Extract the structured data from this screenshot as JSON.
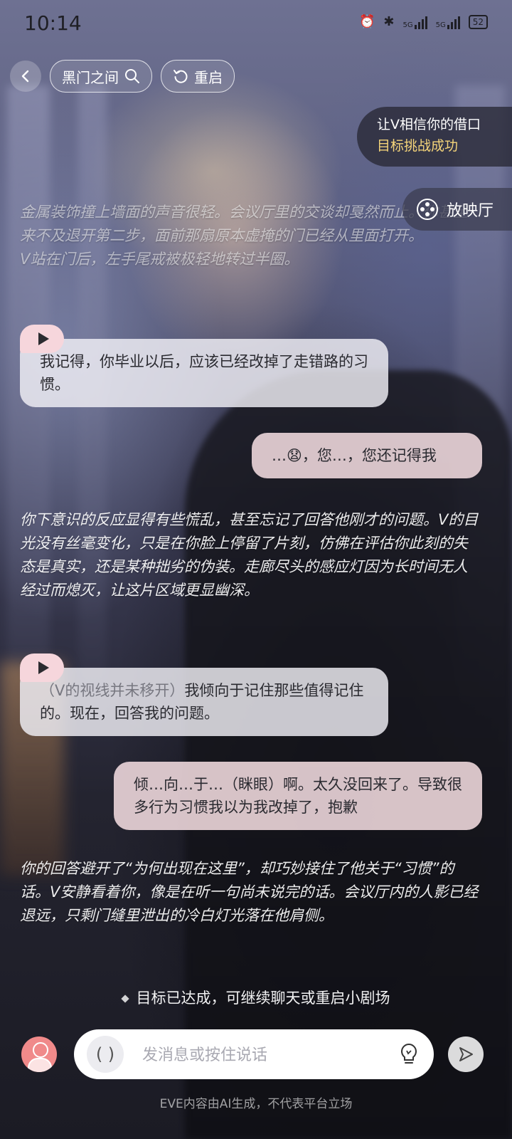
{
  "status_bar": {
    "time": "10:14",
    "battery": "52",
    "network_1": "5G",
    "network_2": "5G"
  },
  "topbar": {
    "back_icon": "chevron-left-icon",
    "scene_title": "黑门之间",
    "restart_label": "重启"
  },
  "goal_card": {
    "line1": "让V相信你的借口",
    "line2": "目标挑战成功",
    "line2_color": "#f4d47a"
  },
  "theater_button": {
    "label": "放映厅",
    "icon": "film-reel-icon"
  },
  "messages": [
    {
      "type": "narration",
      "text": "金属装饰撞上墙面的声音很轻。会议厅里的交谈却戛然而止。你甚至来不及退开第二步，面前那扇原本虚掩的门已经从里面打开。\nV站在门后，左手尾戒被极轻地转过半圈。"
    },
    {
      "type": "ai",
      "text": "我记得，你毕业以后，应该已经改掉了走错路的习惯。"
    },
    {
      "type": "me",
      "text": "…😧，您…，您还记得我"
    },
    {
      "type": "narration",
      "text": "你下意识的反应显得有些慌乱，甚至忘记了回答他刚才的问题。V的目光没有丝毫变化，只是在你脸上停留了片刻，仿佛在评估你此刻的失态是真实，还是某种拙劣的伪装。走廊尽头的感应灯因为长时间无人经过而熄灭，让这片区域更显幽深。"
    },
    {
      "type": "ai",
      "action": "（V的视线并未移开）",
      "text": "我倾向于记住那些值得记住的。现在，回答我的问题。"
    },
    {
      "type": "me",
      "text": "倾…向…于…（眯眼）啊。太久没回来了。导致很多行为习惯我以为我改掉了，抱歉"
    },
    {
      "type": "narration",
      "text": "你的回答避开了“为何出现在这里”，却巧妙接住了他关于“习惯”的话。V安静看着你，像是在听一句尚未说完的话。会议厅内的人影已经退远，只剩门缝里泄出的冷白灯光落在他肩侧。"
    }
  ],
  "goal_done_text": "目标已达成，可继续聊天或重启小剧场",
  "input": {
    "placeholder": "发消息或按住说话",
    "voice_icon": "voice-toggle-icon",
    "hint_icon": "lightbulb-icon",
    "send_icon": "send-icon"
  },
  "disclaimer": "EVE内容由AI生成，不代表平台立场"
}
